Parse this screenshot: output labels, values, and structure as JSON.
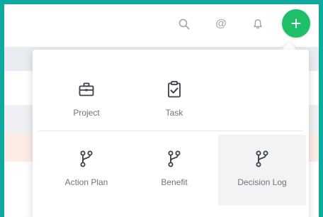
{
  "topbar": {
    "icons": {
      "search": "search-icon",
      "mention": "at-sign-icon",
      "notifications": "bell-icon",
      "add": "plus-icon"
    },
    "at_symbol": "@",
    "add_symbol": "+",
    "add_color": "#1fbf6a"
  },
  "dropdown": {
    "items": [
      {
        "label": "Project",
        "icon": "briefcase-icon"
      },
      {
        "label": "Task",
        "icon": "clipboard-check-icon"
      },
      {
        "label": "Action Plan",
        "icon": "git-branch-icon"
      },
      {
        "label": "Benefit",
        "icon": "git-branch-icon"
      },
      {
        "label": "Decision Log",
        "icon": "git-branch-icon"
      }
    ]
  },
  "colors": {
    "frame_border": "#10a99f",
    "icon_dark": "#3b4047",
    "label": "#6f747a"
  }
}
